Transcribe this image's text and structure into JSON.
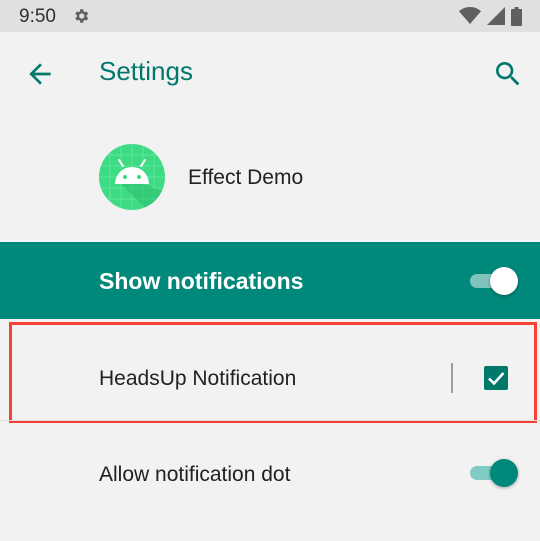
{
  "status_bar": {
    "time": "9:50"
  },
  "app_bar": {
    "title": "Settings"
  },
  "app": {
    "name": "Effect Demo"
  },
  "master": {
    "label": "Show notifications",
    "enabled": true
  },
  "options": {
    "headsup": {
      "label": "HeadsUp Notification",
      "checked": true
    },
    "notification_dot": {
      "label": "Allow notification dot",
      "enabled": true
    }
  },
  "colors": {
    "accent": "#00796b",
    "master_bar": "#00897b",
    "highlight": "#f44336",
    "android_green": "#3ddc84"
  },
  "icons": [
    "gear-icon",
    "wifi-icon",
    "cell-signal-icon",
    "battery-icon",
    "back-arrow-icon",
    "search-icon",
    "android-app-icon",
    "checkmark-icon"
  ]
}
